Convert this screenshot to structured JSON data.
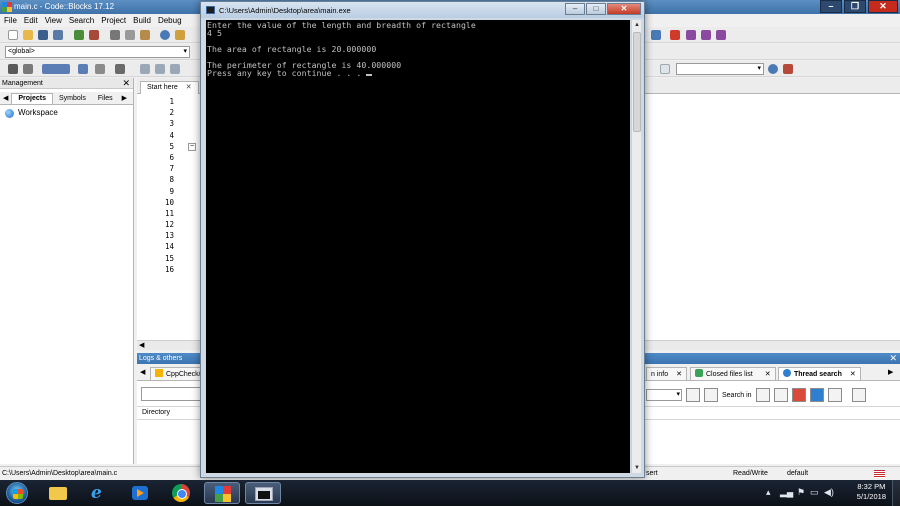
{
  "codeblocks": {
    "title": "main.c - Code::Blocks 17.12",
    "menu": [
      "File",
      "Edit",
      "View",
      "Search",
      "Project",
      "Build",
      "Debug"
    ],
    "global_scope": "<global>",
    "management": {
      "header": "Management",
      "tabs": [
        "Projects",
        "Symbols",
        "Files"
      ],
      "workspace_label": "Workspace"
    },
    "editor": {
      "start_tab": "Start here",
      "line_numbers": [
        "1",
        "2",
        "3",
        "4",
        "5",
        "6",
        "7",
        "8",
        "9",
        "10",
        "11",
        "12",
        "13",
        "14",
        "15",
        "16"
      ]
    },
    "logs": {
      "header": "Logs & others",
      "tabs": {
        "cppcheck": "CppCheck/",
        "info": "n info",
        "closed_files": "Closed files list",
        "thread_search": "Thread search"
      },
      "search_in_label": "Search in",
      "directory_header": "Directory"
    },
    "statusbar": {
      "file_path": "C:\\Users\\Admin\\Desktop\\area\\main.c",
      "insert": "sert",
      "mode": "Read/Write",
      "profile": "default"
    }
  },
  "console": {
    "title": "C:\\Users\\Admin\\Desktop\\area\\main.exe",
    "lines": [
      "Enter the value of the length and breadth of rectangle",
      "4 5",
      "",
      "The area of rectangle is 20.000000",
      "",
      "The perimeter of rectangle is 40.000000",
      "Press any key to continue . . . "
    ]
  },
  "taskbar": {
    "time": "8:32 PM",
    "date": "5/1/2018"
  }
}
